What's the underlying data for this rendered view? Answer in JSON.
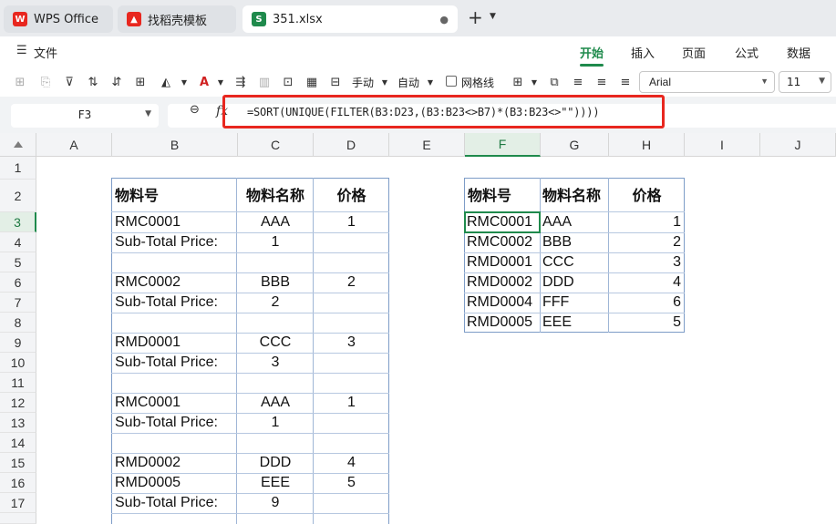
{
  "tabs": [
    {
      "label": "WPS Office",
      "icon": "wps-logo-icon",
      "color": "#e8271f"
    },
    {
      "label": "找稻壳模板",
      "icon": "docer-logo-icon",
      "color": "#e8271f"
    },
    {
      "label": "351.xlsx",
      "icon": "spreadsheet-icon",
      "color": "#1f8a4c",
      "badge": "S",
      "close": "●"
    }
  ],
  "tabbar": {
    "plus": "+",
    "chevron": "⌄"
  },
  "menu": {
    "hamburger": "☰",
    "file": "文件",
    "ribbon_tabs": [
      "开始",
      "插入",
      "页面",
      "公式",
      "数据"
    ]
  },
  "toolbar": {
    "manual_label": "手动",
    "auto_label": "自动",
    "gridlines_label": "网格线",
    "font": "Arial",
    "font_size": "11"
  },
  "formula_bar": {
    "name_box": "F3",
    "fx": "fx",
    "formula": "=SORT(UNIQUE(FILTER(B3:D23,(B3:B23<>B7)*(B3:B23<>\"\"))))"
  },
  "columns": [
    "A",
    "B",
    "C",
    "D",
    "E",
    "F",
    "G",
    "H",
    "I",
    "J"
  ],
  "rows": [
    "1",
    "2",
    "3",
    "4",
    "5",
    "6",
    "7",
    "8",
    "9",
    "10",
    "11",
    "12",
    "13",
    "14",
    "15",
    "16",
    "17"
  ],
  "left_table": {
    "headers": [
      "物料号",
      "物料名称",
      "价格"
    ],
    "rows": [
      [
        "RMC0001",
        "AAA",
        "1"
      ],
      [
        "Sub-Total Price:",
        "1",
        ""
      ],
      [
        "",
        "",
        ""
      ],
      [
        "RMC0002",
        "BBB",
        "2"
      ],
      [
        "Sub-Total Price:",
        "2",
        ""
      ],
      [
        "",
        "",
        ""
      ],
      [
        "RMD0001",
        "CCC",
        "3"
      ],
      [
        "Sub-Total Price:",
        "3",
        ""
      ],
      [
        "",
        "",
        ""
      ],
      [
        "RMC0001",
        "AAA",
        "1"
      ],
      [
        "Sub-Total Price:",
        "1",
        ""
      ],
      [
        "",
        "",
        ""
      ],
      [
        "RMD0002",
        "DDD",
        "4"
      ],
      [
        "RMD0005",
        "EEE",
        "5"
      ],
      [
        "Sub-Total Price:",
        "9",
        ""
      ]
    ]
  },
  "right_table": {
    "headers": [
      "物料号",
      "物料名称",
      "价格"
    ],
    "rows": [
      [
        "RMC0001",
        "AAA",
        "1"
      ],
      [
        "RMC0002",
        "BBB",
        "2"
      ],
      [
        "RMD0001",
        "CCC",
        "3"
      ],
      [
        "RMD0002",
        "DDD",
        "4"
      ],
      [
        "RMD0004",
        "FFF",
        "6"
      ],
      [
        "RMD0005",
        "EEE",
        "5"
      ]
    ]
  },
  "colors": {
    "accent": "#1f8a4c",
    "highlight": "#e8271f",
    "table_border": "#7d9cc7"
  }
}
